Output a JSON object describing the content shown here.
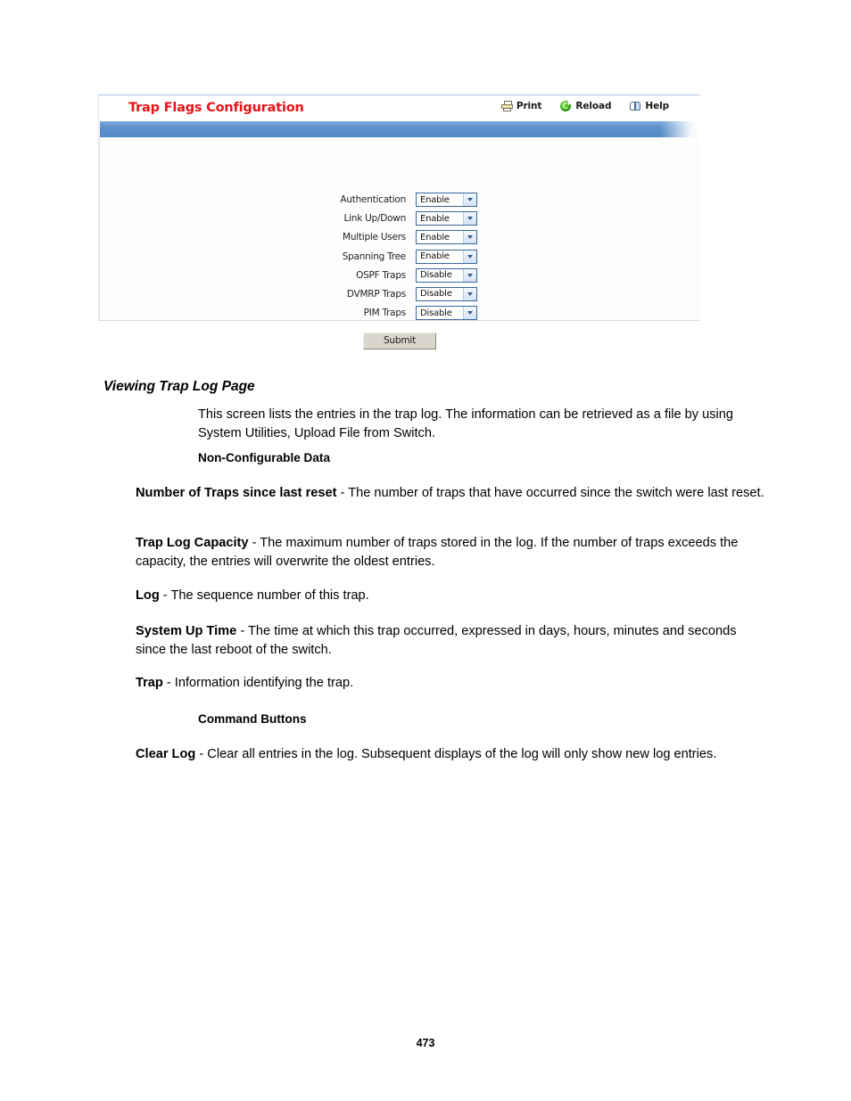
{
  "screenshot": {
    "title": "Trap Flags Configuration",
    "toolbar": [
      {
        "icon": "print-icon",
        "label": "Print"
      },
      {
        "icon": "reload-icon",
        "label": "Reload"
      },
      {
        "icon": "help-icon",
        "label": "Help"
      }
    ],
    "form_rows": [
      {
        "label": "Authentication",
        "value": "Enable"
      },
      {
        "label": "Link Up/Down",
        "value": "Enable"
      },
      {
        "label": "Multiple Users",
        "value": "Enable"
      },
      {
        "label": "Spanning Tree",
        "value": "Enable"
      },
      {
        "label": "OSPF Traps",
        "value": "Disable"
      },
      {
        "label": "DVMRP Traps",
        "value": "Disable"
      },
      {
        "label": "PIM Traps",
        "value": "Disable"
      }
    ],
    "submit_label": "Submit",
    "colors": {
      "title_red": "#e8141a",
      "band_blue": "#5b8fc9",
      "select_border": "#35689d"
    }
  },
  "document": {
    "section_heading": "Viewing Trap Log Page",
    "intro": "This screen lists the entries in the trap log. The information can be retrieved as a file by using System Utilities, Upload File from Switch.",
    "subheading_noncfg": "Non-Configurable Data",
    "items": [
      {
        "term": "Number of Traps since last reset",
        "desc": " - The number of traps that have occurred since the switch were last reset."
      },
      {
        "term": "Trap Log Capacity",
        "desc": " - The maximum number of traps stored in the log. If the number of traps exceeds the capacity, the entries will overwrite the oldest entries."
      },
      {
        "term": "Log",
        "desc": " - The sequence number of this trap."
      },
      {
        "term": "System Up Time",
        "desc": " - The time at which this trap occurred, expressed in days, hours, minutes and seconds since the last reboot of the switch."
      },
      {
        "term": "Trap",
        "desc": " - Information identifying the trap."
      }
    ],
    "subheading_cmd": "Command Buttons",
    "command_item": {
      "term": "Clear Log",
      "desc": " - Clear all entries in the log. Subsequent displays of the log will only show new log entries."
    },
    "page_number": "473"
  }
}
